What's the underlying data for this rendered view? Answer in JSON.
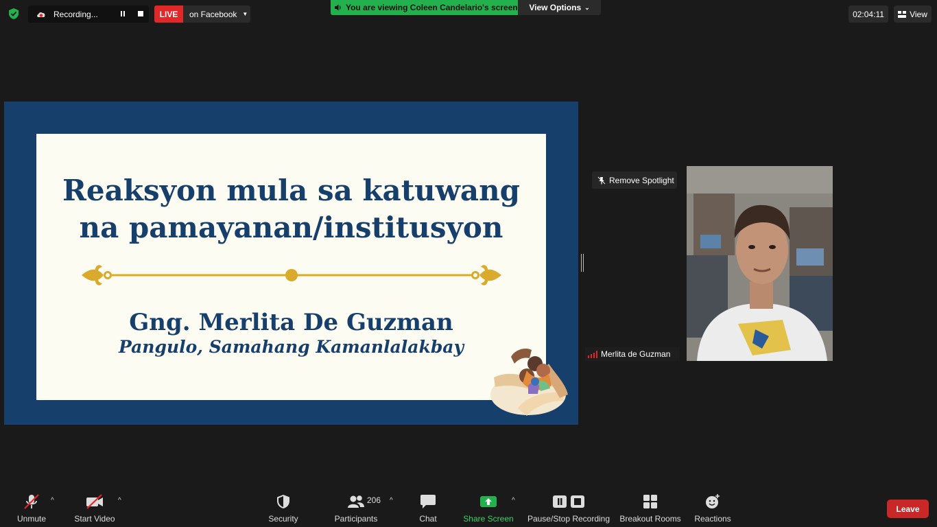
{
  "topbar": {
    "recording_label": "Recording...",
    "live_label": "LIVE",
    "live_destination": "on Facebook",
    "viewing_text": "You are viewing Coleen Candelario's screen",
    "view_options_label": "View Options",
    "meeting_timer": "02:04:11",
    "view_label": "View"
  },
  "slide": {
    "title_line1": "Reaksyon mula sa katuwang",
    "title_line2": "na pamayanan/institusyon",
    "speaker_name": "Gng. Merlita De Guzman",
    "speaker_role": "Pangulo, Samahang Kamanlalakbay"
  },
  "spotlight": {
    "remove_label": "Remove Spotlight",
    "participant_name": "Merlita de Guzman"
  },
  "toolbar": {
    "unmute": "Unmute",
    "start_video": "Start Video",
    "security": "Security",
    "participants": "Participants",
    "participants_count": "206",
    "chat": "Chat",
    "share_screen": "Share Screen",
    "pause_stop_recording": "Pause/Stop Recording",
    "breakout_rooms": "Breakout Rooms",
    "reactions": "Reactions",
    "leave": "Leave"
  },
  "colors": {
    "background": "#1a1a1a",
    "live_red": "#e02828",
    "viewing_green": "#22b14c",
    "share_green": "#22b14c",
    "slide_blue": "#163f6b",
    "slide_cream": "#fdfcf2",
    "ornament_gold": "#d9aa2c",
    "leave_red": "#c82828"
  }
}
